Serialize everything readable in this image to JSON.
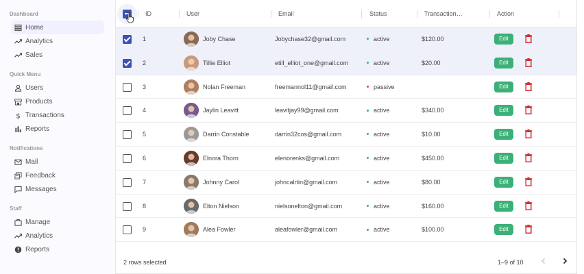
{
  "sidebar": {
    "sections": [
      {
        "title": "Dashboard",
        "items": [
          {
            "label": "Home",
            "icon": "home-icon",
            "active": true
          },
          {
            "label": "Analytics",
            "icon": "trending-icon"
          },
          {
            "label": "Sales",
            "icon": "trending-icon"
          }
        ]
      },
      {
        "title": "Quick Menu",
        "items": [
          {
            "label": "Users",
            "icon": "person-icon"
          },
          {
            "label": "Products",
            "icon": "storefront-icon"
          },
          {
            "label": "Transactions",
            "icon": "dollar-icon"
          },
          {
            "label": "Reports",
            "icon": "bar-chart-icon"
          }
        ]
      },
      {
        "title": "Notifications",
        "items": [
          {
            "label": "Mail",
            "icon": "mail-icon"
          },
          {
            "label": "Feedback",
            "icon": "feedback-icon"
          },
          {
            "label": "Messages",
            "icon": "chat-icon"
          }
        ]
      },
      {
        "title": "Staff",
        "items": [
          {
            "label": "Manage",
            "icon": "briefcase-icon"
          },
          {
            "label": "Analytics",
            "icon": "trending-icon"
          },
          {
            "label": "Reports",
            "icon": "report-icon"
          }
        ]
      }
    ]
  },
  "table": {
    "headers": {
      "id": "ID",
      "user": "User",
      "email": "Email",
      "status": "Status",
      "transaction": "Transaction…",
      "action": "Action"
    },
    "edit_label": "Edit",
    "status_colors": {
      "active": "#3bb077",
      "passive": "#e8384f"
    },
    "rows": [
      {
        "id": "1",
        "name": "Joby Chase",
        "email": "Jobychase32@gmail.com",
        "status": "active",
        "transaction": "$120.00",
        "selected": true,
        "avatar_color": "#8a6a55"
      },
      {
        "id": "2",
        "name": "Tillie Elliot",
        "email": "etill_elliot_one@gmail.com",
        "status": "active",
        "transaction": "$20.00",
        "selected": true,
        "avatar_color": "#c89a7a"
      },
      {
        "id": "3",
        "name": "Nolan Freeman",
        "email": "freemannol11@gmail.com",
        "status": "passive",
        "transaction": "",
        "selected": false,
        "avatar_color": "#b0805e"
      },
      {
        "id": "4",
        "name": "Jaylin Leavitt",
        "email": "leavitjay99@gmail.com",
        "status": "active",
        "transaction": "$340.00",
        "selected": false,
        "avatar_color": "#7a5a8a"
      },
      {
        "id": "5",
        "name": "Darrin Constable",
        "email": "darrin32cos@gmail.com",
        "status": "active",
        "transaction": "$10.00",
        "selected": false,
        "avatar_color": "#9a9a9a"
      },
      {
        "id": "6",
        "name": "Elnora Thorn",
        "email": "elenorenks@gmail.com",
        "status": "active",
        "transaction": "$450.00",
        "selected": false,
        "avatar_color": "#6a3a2a"
      },
      {
        "id": "7",
        "name": "Johnny Carol",
        "email": "johncalrtin@gmail.com",
        "status": "active",
        "transaction": "$80.00",
        "selected": false,
        "avatar_color": "#8a7a6a"
      },
      {
        "id": "8",
        "name": "Elton Nielson",
        "email": "nielsonelton@gmail.com",
        "status": "active",
        "transaction": "$160.00",
        "selected": false,
        "avatar_color": "#6a6a6a"
      },
      {
        "id": "9",
        "name": "Alea Fowler",
        "email": "aleafowler@gmail.com",
        "status": "active",
        "transaction": "$100.00",
        "selected": false,
        "avatar_color": "#a07a5a"
      }
    ]
  },
  "footer": {
    "selected_text": "2 rows selected",
    "range_text": "1–9 of 10"
  }
}
